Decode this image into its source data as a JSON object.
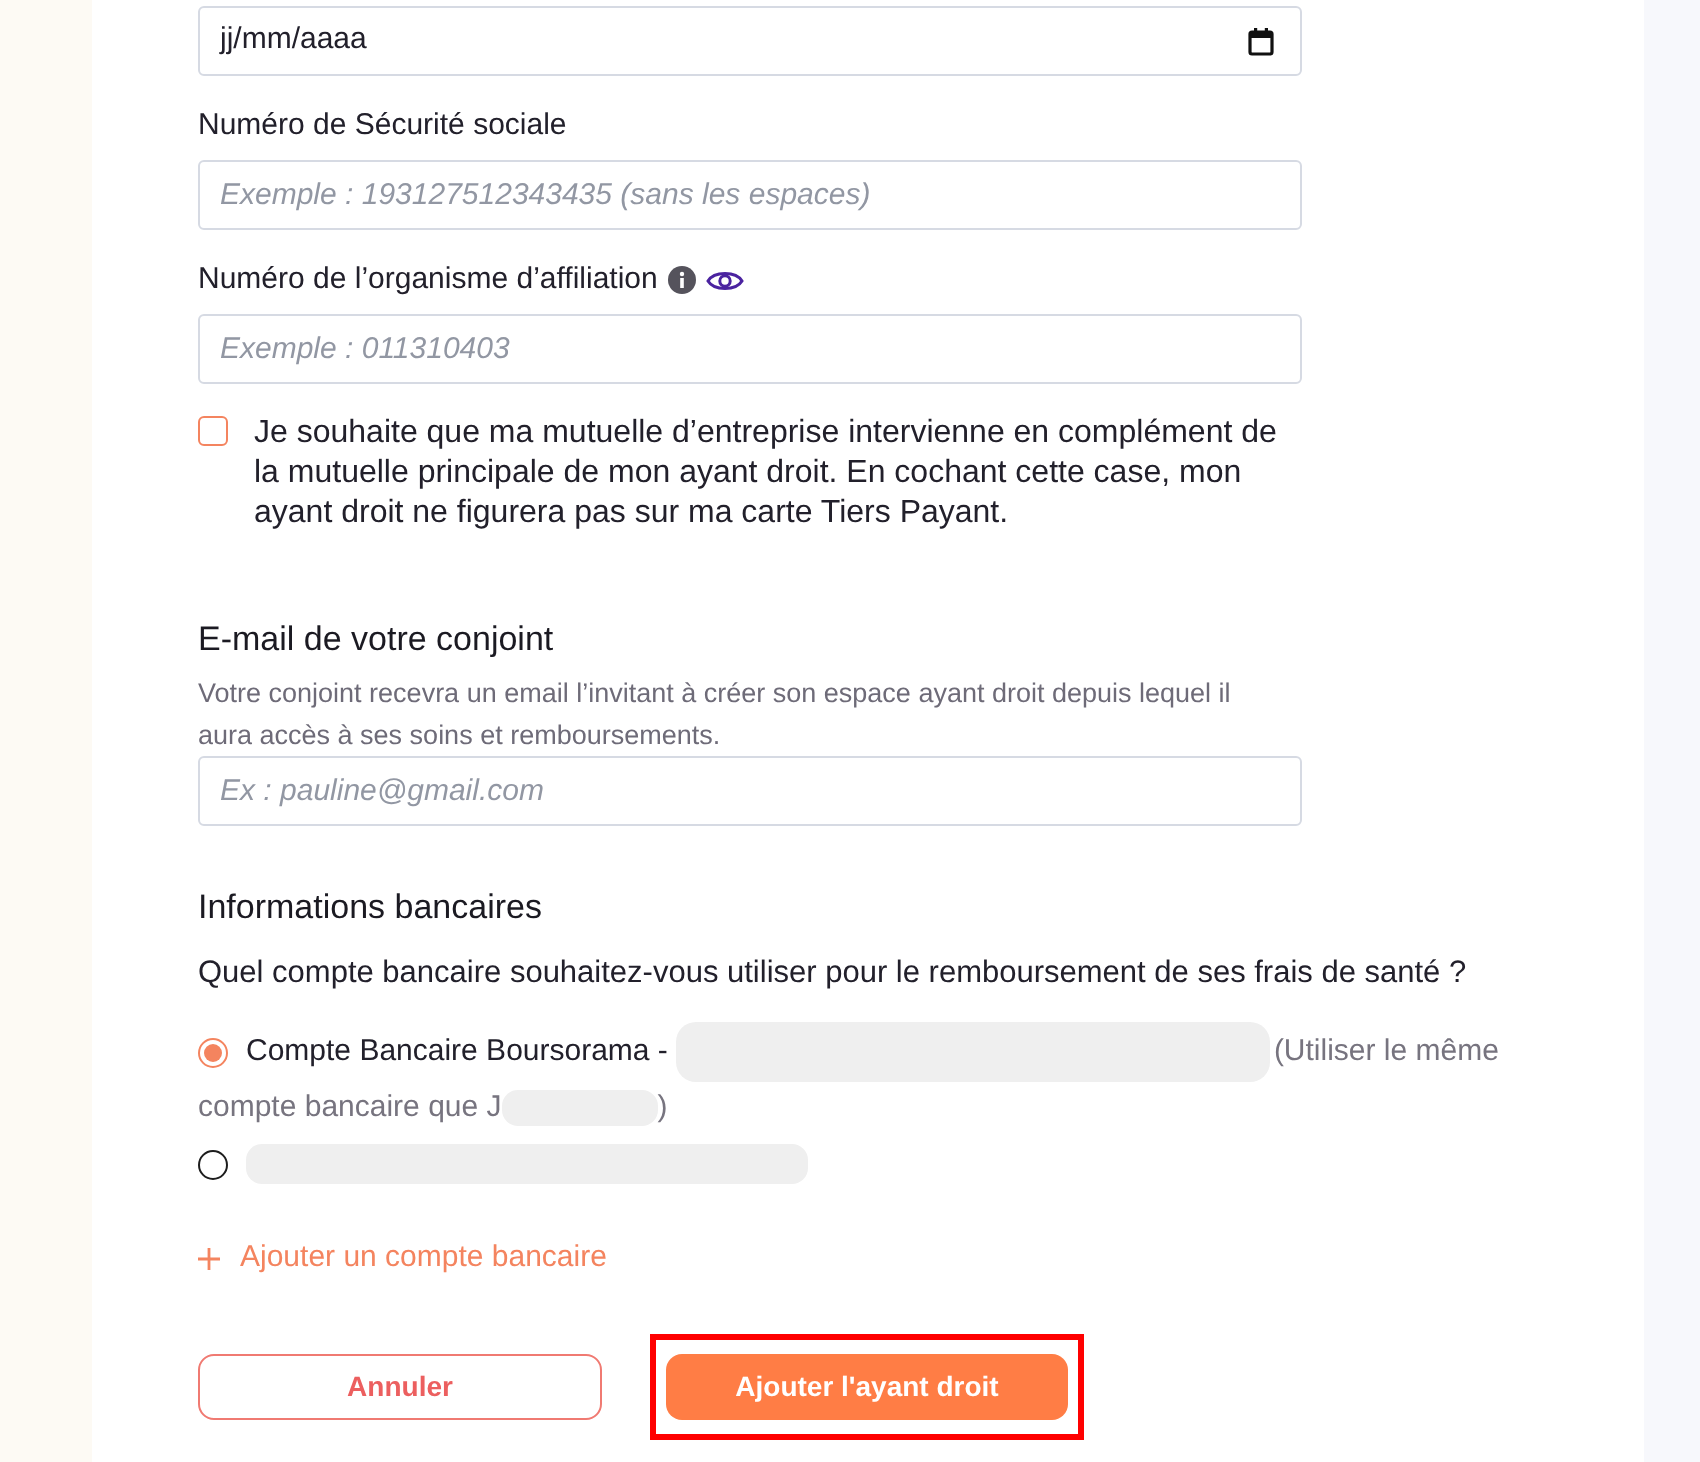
{
  "date_field": {
    "placeholder": "jj/mm/aaaa"
  },
  "fields": [
    {
      "kind": "plain",
      "label": "Numéro de Sécurité sociale",
      "placeholder": "Exemple : 193127512343435 (sans les espaces)"
    },
    {
      "kind": "with_help",
      "label": "Numéro de l’organisme d’affiliation",
      "placeholder": "Exemple : 011310403"
    }
  ],
  "consent_checkbox": {
    "label": "Je souhaite que ma mutuelle d’entreprise intervienne en complément de la mutuelle principale de mon ayant droit. En cochant cette case, mon ayant droit ne figurera pas sur ma carte Tiers Payant.",
    "checked": false
  },
  "spouse_email": {
    "title": "E-mail de votre conjoint",
    "description": "Votre conjoint recevra un email l’invitant à créer son espace ayant droit depuis lequel il aura accès à ses soins et remboursements.",
    "placeholder": "Ex : pauline@gmail.com"
  },
  "bank_info": {
    "title": "Informations bancaires",
    "question": "Quel compte bancaire souhaitez-vous utiliser pour le remboursement de ses frais de santé ?",
    "accounts": [
      {
        "kind": "named",
        "label": "Compte Bancaire Boursorama -",
        "note": "(Utiliser le même",
        "note_continued": "compte bancaire que J",
        "note_end": ")",
        "selected": true
      },
      {
        "kind": "redacted",
        "selected": false
      }
    ],
    "add_account": "Ajouter un compte bancaire"
  },
  "buttons": [
    {
      "kind": "secondary",
      "label": "Annuler",
      "highlighted": false
    },
    {
      "kind": "primary",
      "label": "Ajouter l'ayant droit",
      "highlighted": true
    }
  ]
}
